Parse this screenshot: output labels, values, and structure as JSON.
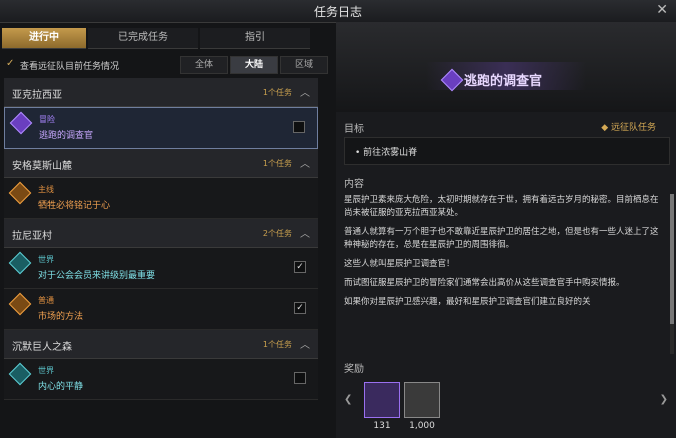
{
  "window": {
    "title": "任务日志",
    "close": "✕"
  },
  "tabs": [
    {
      "label": "进行中"
    },
    {
      "label": "已完成任务"
    },
    {
      "label": "指引"
    }
  ],
  "filter": {
    "checkbox": "✓",
    "label": "查看远征队目前任务情况",
    "segments": [
      "全体",
      "大陆",
      "区域"
    ]
  },
  "regions": [
    {
      "name": "亚克拉西亚",
      "count": "1个任务",
      "chev": "︿"
    },
    {
      "name": "安格莫斯山麓",
      "count": "1个任务",
      "chev": "︿"
    },
    {
      "name": "拉尼亚村",
      "count": "2个任务",
      "chev": "︿"
    },
    {
      "name": "沉默巨人之森",
      "count": "1个任务",
      "chev": "︿"
    }
  ],
  "quests": [
    {
      "type": "冒险",
      "name": "逃跑的调查官",
      "check": ""
    },
    {
      "type": "主线",
      "name": "牺牲必将铭记于心",
      "check": ""
    },
    {
      "type": "世界",
      "name": "对于公会会员来讲级别最重要",
      "check": "✓"
    },
    {
      "type": "普通",
      "name": "市场的方法",
      "check": "✓"
    },
    {
      "type": "世界",
      "name": "内心的平静",
      "check": ""
    }
  ],
  "detail": {
    "title": "逃跑的调查官",
    "goal_label": "目标",
    "party_tag": "◆ 远征队任务",
    "goal_item": "• 前往浓雾山脊",
    "content_label": "内容",
    "content": [
      "星辰护卫素来庞大危险，太初时期就存在于世，拥有着远古岁月的秘密。目前栖息在尚未被征服的亚克拉西亚某处。",
      "普通人就算有一万个胆子也不敢靠近星辰护卫的居住之地，但是也有一些人迷上了这种神秘的存在，总是在星辰护卫的周围徘徊。",
      "这些人就叫星辰护卫调查官！",
      "而试图征服星辰护卫的冒险家们通常会出高价从这些调查官手中购买情报。",
      "如果你对星辰护卫感兴趣，最好和星辰护卫调查官们建立良好的关"
    ],
    "reward_label": "奖励",
    "rewards": [
      {
        "count": "131"
      },
      {
        "count": "1,000"
      }
    ],
    "arrow_left": "❮",
    "arrow_right": "❯"
  }
}
